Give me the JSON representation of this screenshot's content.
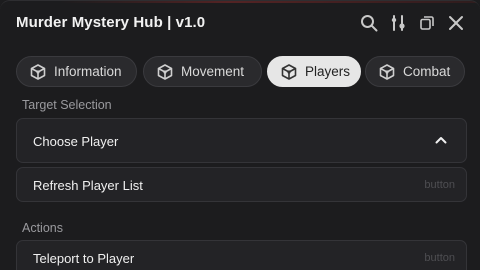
{
  "window": {
    "title": "Murder Mystery Hub | v1.0",
    "controls": [
      "search-icon",
      "sliders-icon",
      "minimize-icon",
      "close-icon"
    ]
  },
  "tabs": [
    {
      "label": "Information",
      "icon": "cube-icon",
      "active": false
    },
    {
      "label": "Movement",
      "icon": "cube-icon",
      "active": false
    },
    {
      "label": "Players",
      "icon": "cube-icon",
      "active": true
    },
    {
      "label": "Combat",
      "icon": "cube-icon",
      "active": false
    }
  ],
  "sections": {
    "target": {
      "label": "Target Selection",
      "dropdown": {
        "label": "Choose Player",
        "icon": "chevron-up-icon"
      },
      "refresh": {
        "label": "Refresh Player List",
        "hint": "button"
      }
    },
    "actions": {
      "label": "Actions",
      "teleport": {
        "label": "Teleport to Player",
        "hint": "button"
      }
    }
  },
  "colors": {
    "background": "#1c1c1e",
    "card": "#232326",
    "active_tab": "#e6e6e6",
    "muted_text": "#9a9a9e"
  }
}
